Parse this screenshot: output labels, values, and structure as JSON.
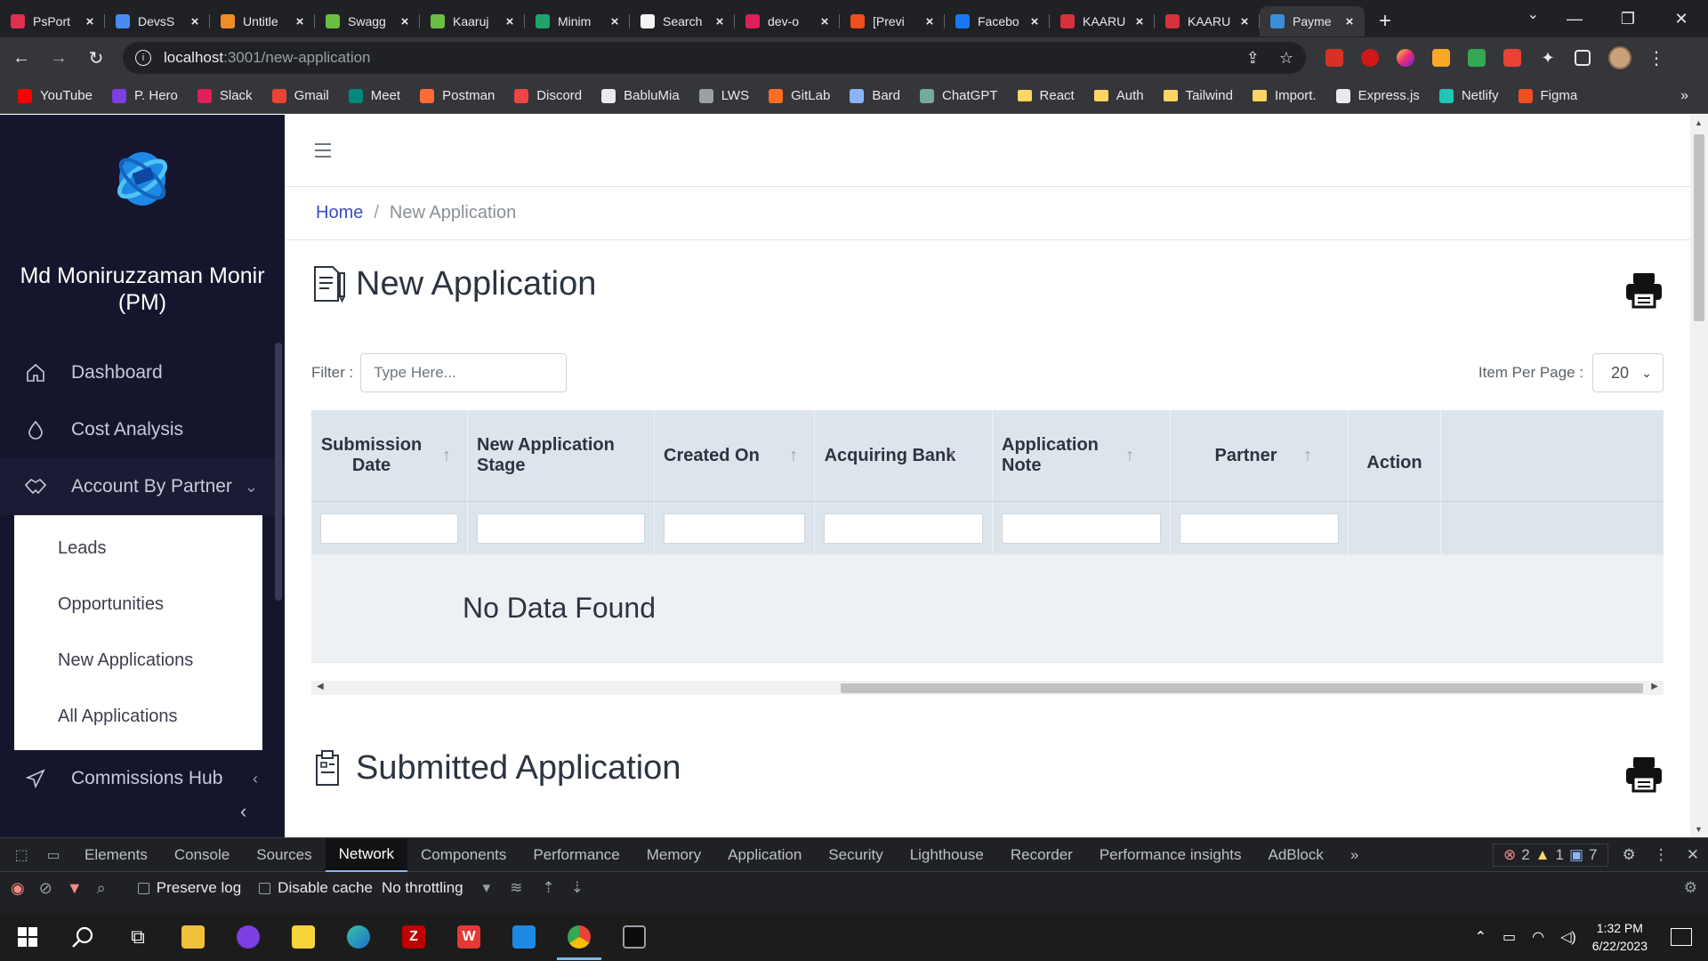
{
  "browser": {
    "tabs": [
      {
        "title": "PsPort",
        "color": "#e02f4f"
      },
      {
        "title": "DevsS",
        "color": "#4a8af4"
      },
      {
        "title": "Untitle",
        "color": "#f28c28"
      },
      {
        "title": "Swagg",
        "color": "#6abf40"
      },
      {
        "title": "Kaaruj",
        "color": "#6abf40"
      },
      {
        "title": "Minim",
        "color": "#1fa36b"
      },
      {
        "title": "Search",
        "color": "#f4f4f4"
      },
      {
        "title": "dev-o",
        "color": "#e01e5a"
      },
      {
        "title": "[Previ",
        "color": "#f24e1e"
      },
      {
        "title": "Facebo",
        "color": "#1877f2"
      },
      {
        "title": "KAARU",
        "color": "#d6313c"
      },
      {
        "title": "KAARU",
        "color": "#d6313c"
      },
      {
        "title": "Payme",
        "color": "#3b8fd9"
      }
    ],
    "active_tab_index": 12,
    "url_host": "localhost",
    "url_path": ":3001/new-application",
    "bookmarks": [
      {
        "label": "YouTube",
        "color": "#ff0000",
        "type": "site"
      },
      {
        "label": "P. Hero",
        "color": "#7b3fe4",
        "type": "site"
      },
      {
        "label": "Slack",
        "color": "#e01e5a",
        "type": "site"
      },
      {
        "label": "Gmail",
        "color": "#ea4335",
        "type": "site"
      },
      {
        "label": "Meet",
        "color": "#00897b",
        "type": "site"
      },
      {
        "label": "Postman",
        "color": "#ff6c37",
        "type": "site"
      },
      {
        "label": "Discord",
        "color": "#ef4444",
        "type": "site"
      },
      {
        "label": "BabluMia",
        "color": "#e8eaed",
        "type": "site"
      },
      {
        "label": "LWS",
        "color": "#9aa0a6",
        "type": "site"
      },
      {
        "label": "GitLab",
        "color": "#fc6d26",
        "type": "site"
      },
      {
        "label": "Bard",
        "color": "#8ab4f8",
        "type": "site"
      },
      {
        "label": "ChatGPT",
        "color": "#74aa9c",
        "type": "site"
      },
      {
        "label": "React",
        "type": "folder"
      },
      {
        "label": "Auth",
        "type": "folder"
      },
      {
        "label": "Tailwind",
        "type": "folder"
      },
      {
        "label": "Import.",
        "type": "folder"
      },
      {
        "label": "Express.js",
        "color": "#e8eaed",
        "type": "site"
      },
      {
        "label": "Netlify",
        "color": "#20c6b7",
        "type": "site"
      },
      {
        "label": "Figma",
        "color": "#f24e1e",
        "type": "site"
      }
    ]
  },
  "sidebar": {
    "user_name": "Md Moniruzzaman Monir (PM)",
    "items": [
      {
        "label": "Dashboard",
        "icon": "home-icon"
      },
      {
        "label": "Cost Analysis",
        "icon": "drop-icon"
      },
      {
        "label": "Account By Partner",
        "icon": "handshake-icon",
        "expanded": true
      },
      {
        "label": "Commissions Hub",
        "icon": "send-icon"
      }
    ],
    "submenu": [
      "Leads",
      "Opportunities",
      "New Applications",
      "All Applications"
    ]
  },
  "breadcrumb": {
    "home": "Home",
    "current": "New Application"
  },
  "new_application": {
    "title": "New Application",
    "filter_label": "Filter :",
    "filter_placeholder": "Type Here...",
    "items_per_page_label": "Item Per Page :",
    "items_per_page_value": "20",
    "columns": [
      {
        "label": "Submission Date",
        "sortable": true
      },
      {
        "label": "New Application Stage",
        "sortable": false
      },
      {
        "label": "Created On",
        "sortable": true
      },
      {
        "label": "Acquiring Bank",
        "sortable": true
      },
      {
        "label": "Application Note",
        "sortable": true
      },
      {
        "label": "Partner",
        "sortable": true
      },
      {
        "label": "Action",
        "sortable": false
      }
    ],
    "empty_message": "No Data Found"
  },
  "submitted_application": {
    "title": "Submitted Application"
  },
  "devtools": {
    "tabs": [
      "Elements",
      "Console",
      "Sources",
      "Network",
      "Components",
      "Performance",
      "Memory",
      "Application",
      "Security",
      "Lighthouse",
      "Recorder",
      "Performance insights",
      "AdBlock"
    ],
    "active_tab": "Network",
    "errors": "2",
    "warnings": "1",
    "messages": "7",
    "preserve_log": "Preserve log",
    "disable_cache": "Disable cache",
    "throttling": "No throttling"
  },
  "taskbar": {
    "time": "1:32 PM",
    "date": "6/22/2023"
  }
}
